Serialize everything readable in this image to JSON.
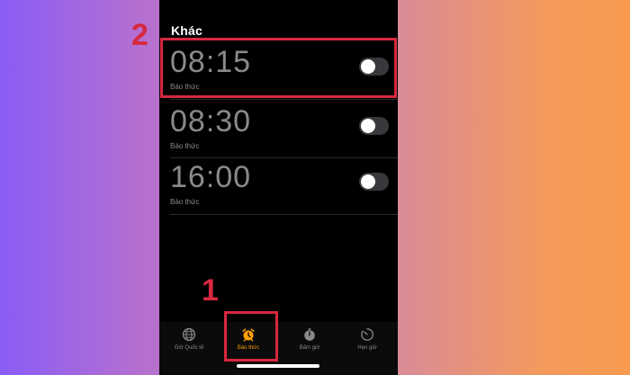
{
  "screen": {
    "section_title": "Khác",
    "alarms": [
      {
        "time": "08:15",
        "label": "Báo thức",
        "enabled": false
      },
      {
        "time": "08:30",
        "label": "Báo thức",
        "enabled": false
      },
      {
        "time": "16:00",
        "label": "Báo thức",
        "enabled": false
      }
    ]
  },
  "tabbar": {
    "tabs": [
      {
        "label": "Giờ Quốc tế",
        "icon": "globe-icon",
        "active": false
      },
      {
        "label": "Báo thức",
        "icon": "alarm-clock-icon",
        "active": true
      },
      {
        "label": "Bấm giờ",
        "icon": "stopwatch-icon",
        "active": false
      },
      {
        "label": "Hẹn giờ",
        "icon": "timer-icon",
        "active": false
      }
    ]
  },
  "annotations": {
    "step1": "1",
    "step2": "2"
  },
  "colors": {
    "accent": "#ff9f0a",
    "annotation": "#d6283f",
    "text_dim": "#8a8a8e",
    "toggle_off": "#39393d"
  }
}
